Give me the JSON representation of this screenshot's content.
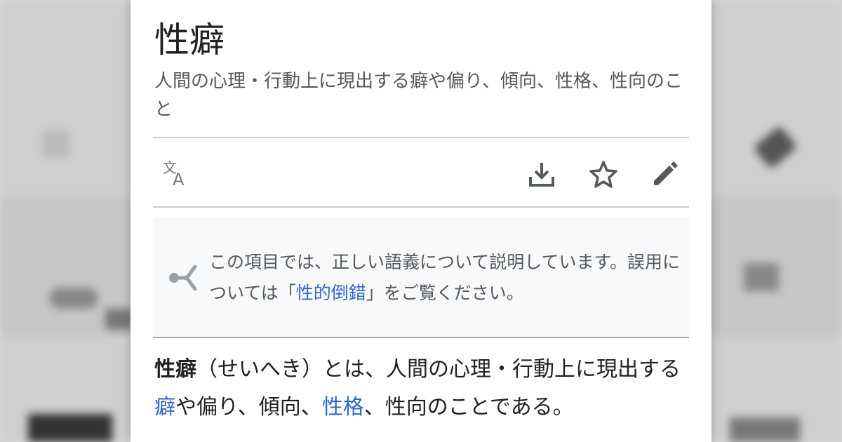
{
  "page": {
    "title": "性癖",
    "description": "人間の心理・行動上に現出する癖や偏り、傾向、性格、性向のこと"
  },
  "toolbar": {
    "language_icon": "translate-icon",
    "download_icon": "download-icon",
    "watch_icon": "star-icon",
    "edit_icon": "pencil-icon"
  },
  "hatnote": {
    "icon": "disambiguation-icon",
    "text_before": "この項目では、正しい語義について説明しています。誤用については「",
    "link": "性的倒錯",
    "text_after": "」をご覧ください。"
  },
  "lead": {
    "term": "性癖",
    "part1": "（せいへき）とは、人間の心理・行動上に現出する",
    "link1": "癖",
    "part2": "や偏り、傾向、",
    "link2": "性格",
    "part3": "、性向のことである。"
  },
  "colors": {
    "link": "#3366cc",
    "text": "#202122",
    "muted": "#54595d",
    "hatnote_bg": "#f8f9fa",
    "divider": "#c8ccd1"
  }
}
